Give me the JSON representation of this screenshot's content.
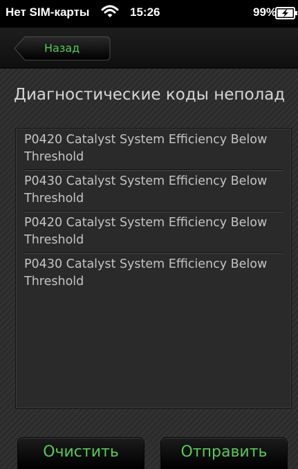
{
  "status_bar": {
    "carrier": "Нет SIM-карты",
    "time": "15:26",
    "battery_percent": "99%",
    "wifi_icon": "wifi-icon",
    "battery_icon": "battery-charging-icon"
  },
  "nav": {
    "back_label": "Назад"
  },
  "page": {
    "title": "Диагностические коды неполад"
  },
  "codes": [
    {
      "text": "P0420 Catalyst System Efficiency Below Threshold"
    },
    {
      "text": "P0430 Catalyst System Efficiency Below Threshold"
    },
    {
      "text": "P0420 Catalyst System Efficiency Below Threshold"
    },
    {
      "text": "P0430 Catalyst System Efficiency Below Threshold"
    }
  ],
  "actions": {
    "clear_label": "Очистить",
    "send_label": "Отправить"
  },
  "colors": {
    "accent": "#58c85a",
    "background": "#2b2b2b",
    "text": "#c4c4c4"
  }
}
